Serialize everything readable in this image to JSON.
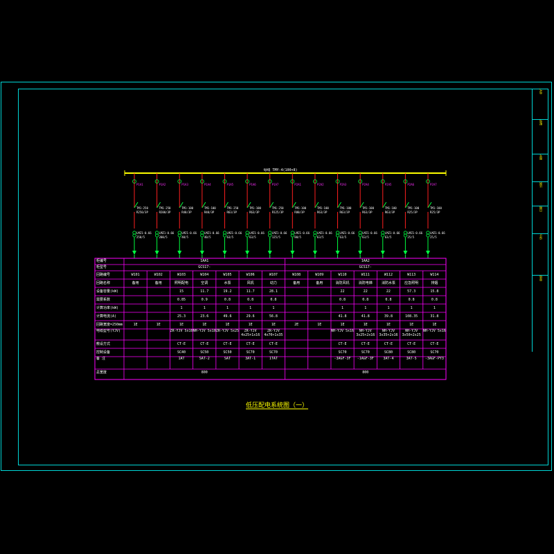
{
  "colors": {
    "frame": "#00d8d8",
    "table": "#ff00ff",
    "bus": "#ffff00",
    "feeder_red": "#ff2020",
    "feeder_green": "#00ff40",
    "label_magenta": "#ff30ff",
    "text_white": "#ffffff",
    "text_yellow": "#ffff00"
  },
  "title_block": [
    "电气",
    "配电",
    "图号",
    "比例",
    "日期",
    "设计",
    "审核"
  ],
  "bus_label": "母线 TMY-4(100×8)",
  "caption": "低压配电系统图（一）",
  "feeders": [
    {
      "type": "N",
      "label": "P1A1",
      "breaker": [
        "TM1-250",
        "R250/3P"
      ],
      "ct": [
        "LMZ1-0.66",
        "250/5"
      ]
    },
    {
      "type": "N",
      "label": "P1A2",
      "breaker": [
        "TM1-250",
        "R200/3P"
      ],
      "ct": [
        "LMZ1-0.66",
        "200/5"
      ]
    },
    {
      "type": "N",
      "label": "P1A3",
      "breaker": [
        "TM1-100",
        "R40/3P"
      ],
      "ct": [
        "LMZ1-0.66",
        "40/5"
      ]
    },
    {
      "type": "N",
      "label": "P1A4",
      "breaker": [
        "TM1-100",
        "R40/3P"
      ],
      "ct": [
        "LMZ1-0.66",
        "40/5"
      ]
    },
    {
      "type": "N",
      "label": "P1A5",
      "breaker": [
        "TM1-250",
        "R63/3P"
      ],
      "ct": [
        "LMZ1-0.66",
        "63/5"
      ]
    },
    {
      "type": "N",
      "label": "P1A6",
      "breaker": [
        "TM1-100",
        "R63/3P"
      ],
      "ct": [
        "LMZ1-0.66",
        "63/5"
      ]
    },
    {
      "type": "N",
      "label": "P1A7",
      "breaker": [
        "TM1-250",
        "R125/3P"
      ],
      "ct": [
        "LMZ1-0.66",
        "125/5"
      ]
    },
    {
      "type": "N",
      "label": "P2A1",
      "breaker": [
        "TM1-100",
        "R80/3P"
      ],
      "ct": [
        "LMZ1-0.66",
        "80/5"
      ]
    },
    {
      "type": "N",
      "label": "P2A2",
      "breaker": [
        "TM1-100",
        "R63/3P"
      ],
      "ct": [
        "LMZ1-0.66",
        "63/5"
      ]
    },
    {
      "type": "N",
      "label": "P2A3",
      "breaker": [
        "TM1-100",
        "R63/3P"
      ],
      "ct": [
        "LMZ1-0.66",
        "63/5"
      ]
    },
    {
      "type": "N",
      "label": "P2A4",
      "breaker": [
        "TM1-100",
        "R63/3P"
      ],
      "ct": [
        "LMZ1-0.66",
        "63/5"
      ]
    },
    {
      "type": "N",
      "label": "P2A5",
      "breaker": [
        "TM1-100",
        "R63/3P"
      ],
      "ct": [
        "LMZ1-0.66",
        "63/5"
      ]
    },
    {
      "type": "N",
      "label": "P2A6",
      "breaker": [
        "TM1-100",
        "R25/3P"
      ],
      "ct": [
        "LMZ1-0.66",
        "25/5"
      ]
    },
    {
      "type": "N",
      "label": "P2A7",
      "breaker": [
        "TM1-100",
        "R25/3P"
      ],
      "ct": [
        "LMZ1-0.66",
        "25/5"
      ]
    }
  ],
  "table": {
    "row_labels": [
      "柜编号",
      "柜型号",
      "回路编号",
      "回路名称",
      "设备容量(kW)",
      "需要系数",
      "计算功率(kW)",
      "计算电流(A)",
      "回路宽度=250mm",
      "电缆型号(YJV)",
      "敷设方式",
      "控制设备",
      "备    注",
      "总宽度"
    ],
    "panel_1": "1AA1",
    "panel_2": "1AA2",
    "cabinet_1": "GCS17-",
    "cabinet_2": "GCS17-",
    "columns": [
      {
        "id": "W101",
        "name": "备用",
        "kw": "",
        "kx": "",
        "pjs": "",
        "ijs": "",
        "width": "1E",
        "cable": "",
        "lay": "",
        "ctrl": "",
        "note": ""
      },
      {
        "id": "W102",
        "name": "备用",
        "kw": "",
        "kx": "",
        "pjs": "",
        "ijs": "",
        "width": "1E",
        "cable": "",
        "lay": "",
        "ctrl": "",
        "note": ""
      },
      {
        "id": "W103",
        "name": "照明配电",
        "kw": "15",
        "kx": "0.85",
        "pjs": "1",
        "ijs": "25.3",
        "width": "1E",
        "cable": "ZR-YJV 5x10",
        "lay": "CT-E",
        "ctrl": "SC40",
        "note": "1AT"
      },
      {
        "id": "W104",
        "name": "空调",
        "kw": "11.7",
        "kx": "0.9",
        "pjs": "1",
        "ijs": "23.6",
        "width": "1E",
        "cable": "NH-YJV 5x10",
        "lay": "CT-E",
        "ctrl": "SC50",
        "note": "SAT-2"
      },
      {
        "id": "W105",
        "name": "水泵",
        "kw": "19.2",
        "kx": "0.8",
        "pjs": "1",
        "ijs": "49.6",
        "width": "1E",
        "cable": "ZR-YJV 5x25",
        "lay": "CT-E",
        "ctrl": "SC50",
        "note": "SAT"
      },
      {
        "id": "W106",
        "name": "风机",
        "kw": "11.7",
        "kx": "0.8",
        "pjs": "1",
        "ijs": "29.6",
        "width": "1E",
        "cable": "ZR-YJV 4x25+1x16",
        "lay": "CT-E",
        "ctrl": "SC70",
        "note": "3AT-1"
      },
      {
        "id": "W107",
        "name": "动力",
        "kw": "28.1",
        "kx": "0.8",
        "pjs": "1",
        "ijs": "56.8",
        "width": "1E",
        "cable": "ZR-YJV 4x70+1x35",
        "lay": "CT-E",
        "ctrl": "SC70",
        "note": "1TAT"
      },
      {
        "id": "W108",
        "name": "备用",
        "kw": "",
        "kx": "",
        "pjs": "",
        "ijs": "",
        "width": "2E",
        "cable": "",
        "lay": "",
        "ctrl": "",
        "note": ""
      },
      {
        "id": "W109",
        "name": "备用",
        "kw": "",
        "kx": "",
        "pjs": "",
        "ijs": "",
        "width": "1E",
        "cable": "",
        "lay": "",
        "ctrl": "",
        "note": ""
      },
      {
        "id": "W110",
        "name": "消防风机",
        "kw": "22",
        "kx": "0.8",
        "pjs": "1",
        "ijs": "41.8",
        "width": "1E",
        "cable": "NH-YJV 5x16",
        "lay": "CT-E",
        "ctrl": "SC70",
        "note": "-3AGF-3F"
      },
      {
        "id": "W111",
        "name": "消防电梯",
        "kw": "22",
        "kx": "0.8",
        "pjs": "1",
        "ijs": "41.8",
        "width": "1E",
        "cable": "NH-YJV 3x25+2x16",
        "lay": "CT-E",
        "ctrl": "SC70",
        "note": "-1AGF-3F"
      },
      {
        "id": "W112",
        "name": "消防水泵",
        "kw": "22",
        "kx": "0.8",
        "pjs": "1",
        "ijs": "39.8",
        "width": "1E",
        "cable": "NH-YJV 3x35+2x16",
        "lay": "CT-E",
        "ctrl": "SC80",
        "note": "3AT-4"
      },
      {
        "id": "W113",
        "name": "应急照明",
        "kw": "57.3",
        "kx": "0.8",
        "pjs": "1",
        "ijs": "108.35",
        "width": "1E",
        "cable": "NH-YJV 3x50+2x25",
        "lay": "CT-E",
        "ctrl": "SC80",
        "note": "3AT-5"
      },
      {
        "id": "W114",
        "name": "排烟",
        "kw": "15.8",
        "kx": "0.8",
        "pjs": "1",
        "ijs": "31.8",
        "width": "1E",
        "cable": "NH-YJV 5x16",
        "lay": "CT-E",
        "ctrl": "SC70",
        "note": "-3AGF-PY3"
      }
    ],
    "total_1": "800",
    "total_2": "800"
  }
}
